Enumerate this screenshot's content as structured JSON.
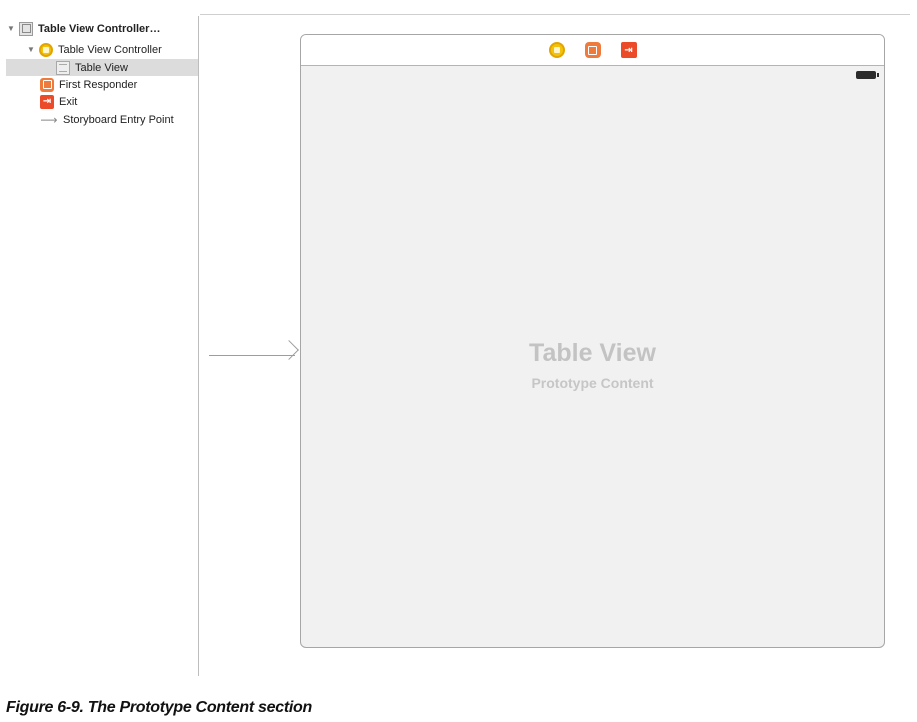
{
  "outline": {
    "items": [
      {
        "label": "Table View Controller…",
        "icon": "scene-icon",
        "expanded": true,
        "bold": true
      },
      {
        "label": "Table View Controller",
        "icon": "view-controller-icon",
        "expanded": true
      },
      {
        "label": "Table View",
        "icon": "table-view-icon",
        "selected": true
      },
      {
        "label": "First Responder",
        "icon": "first-responder-icon"
      },
      {
        "label": "Exit",
        "icon": "exit-icon",
        "glyph": "⇥"
      },
      {
        "label": "Storyboard Entry Point",
        "icon": "entry-arrow-icon",
        "glyph": "⟶"
      }
    ]
  },
  "scene": {
    "dock_icons": [
      "view-controller-icon",
      "first-responder-icon",
      "exit-icon"
    ],
    "exit_glyph": "⇥",
    "table_view_title": "Table View",
    "table_view_subtitle": "Prototype Content"
  },
  "caption": "Figure 6-9.  The Prototype Content section",
  "colors": {
    "view_controller": "#f4c20d",
    "first_responder": "#ee7a3c",
    "exit": "#ec4b2a",
    "placeholder_text": "#c3c3c3"
  }
}
